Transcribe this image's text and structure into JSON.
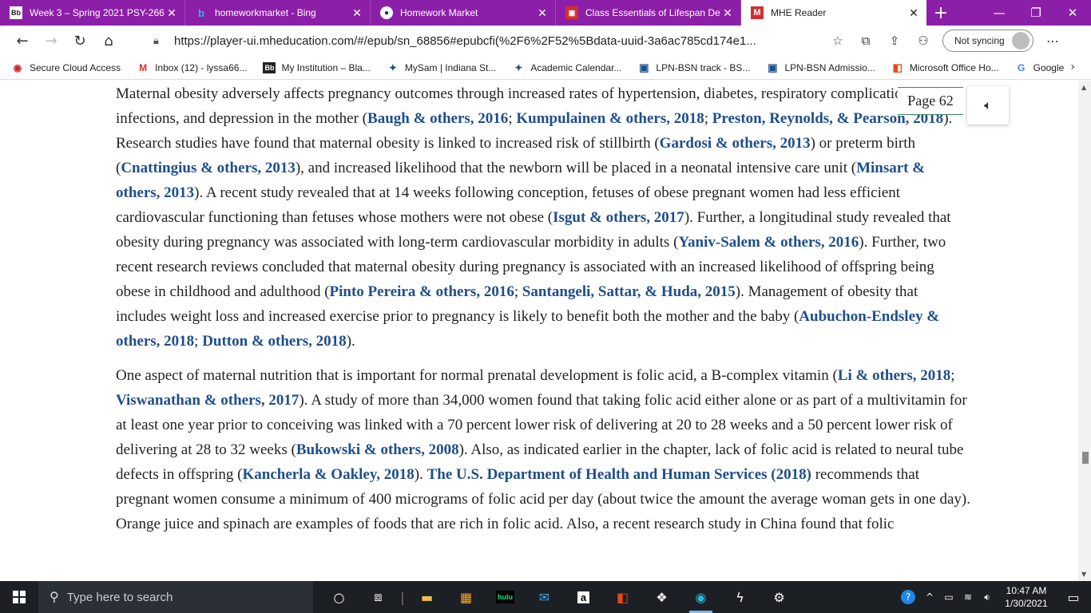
{
  "tabs": [
    {
      "favicon": "Bb",
      "title": "Week 3 – Spring 2021 PSY-266",
      "active": false
    },
    {
      "favicon": "b",
      "title": "homeworkmarket - Bing",
      "active": false
    },
    {
      "favicon": "●",
      "title": "Homework Market",
      "active": false
    },
    {
      "favicon": "▣",
      "title": "Class Essentials of Lifespan De",
      "active": false
    },
    {
      "favicon": "M",
      "title": "MHE Reader",
      "active": true
    }
  ],
  "new_tab_glyph": "+",
  "window_controls": {
    "minimize": "—",
    "restore": "❐",
    "close": "✕"
  },
  "address": {
    "url": "https://player-ui.mheducation.com/#/epub/sn_68856#epubcfi(%2F6%2F52%5Bdata-uuid-3a6ac785cd174e1...",
    "sync_label": "Not syncing"
  },
  "favorites": [
    {
      "icon": "cloud-access-icon",
      "glyph": "◉",
      "color": "#c62828",
      "label": "Secure Cloud Access"
    },
    {
      "icon": "gmail-icon",
      "glyph": "M",
      "color": "#d93025",
      "label": "Inbox (12) - lyssa66..."
    },
    {
      "icon": "blackboard-icon",
      "glyph": "Bb",
      "color": "#222222",
      "label": "My Institution – Bla..."
    },
    {
      "icon": "star-icon",
      "glyph": "✦",
      "color": "#1f4e8c",
      "label": "MySam | Indiana St..."
    },
    {
      "icon": "star-icon",
      "glyph": "✦",
      "color": "#1f4e8c",
      "label": "Academic Calendar..."
    },
    {
      "icon": "bookmark-icon",
      "glyph": "▣",
      "color": "#1f4e8c",
      "label": "LPN-BSN track - BS..."
    },
    {
      "icon": "bookmark-icon",
      "glyph": "▣",
      "color": "#1f4e8c",
      "label": "LPN-BSN Admissio..."
    },
    {
      "icon": "office-icon",
      "glyph": "◧",
      "color": "#e64a19",
      "label": "Microsoft Office Ho..."
    },
    {
      "icon": "google-icon",
      "glyph": "G",
      "color": "#4285f4",
      "label": "Google"
    }
  ],
  "reader": {
    "page_label": "Page 62",
    "paragraph1": [
      {
        "t": "Maternal obesity adversely affects pregnancy outcomes through increased rates of hypertension, diabetes, respiratory complications, infections, and depression in the mother ("
      },
      {
        "c": "Baugh & others, 2016"
      },
      {
        "t": "; "
      },
      {
        "c": "Kumpulainen & others, 2018"
      },
      {
        "t": "; "
      },
      {
        "c": "Preston, Reynolds, & Pearson, 2018"
      },
      {
        "t": "). Research studies have found that maternal obesity is linked to increased risk of stillbirth ("
      },
      {
        "c": "Gardosi & others, 2013"
      },
      {
        "t": ") or preterm birth ("
      },
      {
        "c": "Cnattingius & others, 2013"
      },
      {
        "t": "), and increased likelihood that the newborn will be placed in a neonatal intensive care unit ("
      },
      {
        "c": "Minsart & others, 2013"
      },
      {
        "t": "). A recent study revealed that at 14 weeks following conception, fetuses of obese pregnant women had less efficient cardiovascular functioning than fetuses whose mothers were not obese ("
      },
      {
        "c": "Isgut & others, 2017"
      },
      {
        "t": "). Further, a longitudinal study revealed that obesity during pregnancy was associated with long-term cardiovascular morbidity in adults ("
      },
      {
        "c": "Yaniv-Salem & others, 2016"
      },
      {
        "t": "). Further, two recent research reviews concluded that maternal obesity during pregnancy is associated with an increased likelihood of offspring being obese in childhood and adulthood ("
      },
      {
        "c": "Pinto Pereira & others, 2016"
      },
      {
        "t": "; "
      },
      {
        "c": "Santangeli, Sattar, & Huda, 2015"
      },
      {
        "t": "). Management of obesity that includes weight loss and increased exercise prior to pregnancy is likely to benefit both the mother and the baby ("
      },
      {
        "c": "Aubuchon-Endsley & others, 2018"
      },
      {
        "t": "; "
      },
      {
        "c": "Dutton & others, 2018"
      },
      {
        "t": ")."
      }
    ],
    "paragraph2": [
      {
        "t": "One aspect of maternal nutrition that is important for normal prenatal development is folic acid, a B-complex vitamin ("
      },
      {
        "c": "Li & others, 2018"
      },
      {
        "t": "; "
      },
      {
        "c": "Viswanathan & others, 2017"
      },
      {
        "t": "). A study of more than 34,000 women found that taking folic acid either alone or as part of a multivitamin for at least one year prior to conceiving was linked with a 70 percent lower risk of delivering at 20 to 28 weeks and a 50 percent lower risk of delivering at 28 to 32 weeks ("
      },
      {
        "c": "Bukowski & others, 2008"
      },
      {
        "t": "). Also, as indicated earlier in the chapter, lack of folic acid is related to neural tube defects in offspring ("
      },
      {
        "c": "Kancherla & Oakley, 2018"
      },
      {
        "t": "). "
      },
      {
        "c": "The U.S. Department of Health and Human Services (2018)"
      },
      {
        "t": " recommends that pregnant women consume a minimum of 400 micrograms of folic acid per day (about twice the amount the average woman gets in one day). Orange juice and spinach are examples of foods that are rich in folic acid. Also, a recent research study in China found that folic"
      }
    ]
  },
  "taskbar": {
    "search_placeholder": "Type here to search",
    "hulu_label": "hulu",
    "amazon_label": "a",
    "time": "10:47 AM",
    "date": "1/30/2021"
  }
}
